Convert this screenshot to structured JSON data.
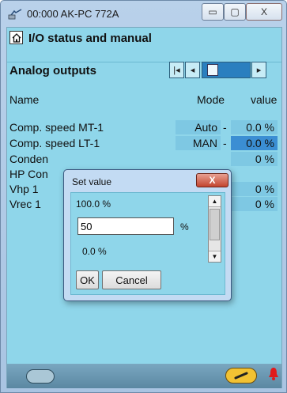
{
  "window": {
    "title": "00:000 AK-PC 772A",
    "min_glyph": "▭",
    "max_glyph": "▢",
    "close_glyph": "X"
  },
  "header": {
    "page_title": "I/O status and manual",
    "section_title": "Analog outputs",
    "nav": {
      "first": "|◂",
      "prev": "◂",
      "next": "▸"
    }
  },
  "table": {
    "headers": {
      "name": "Name",
      "mode": "Mode",
      "value": "value"
    },
    "rows": [
      {
        "name": "Comp. speed MT-1",
        "mode": "Auto",
        "dash": "-",
        "value": "0.0 %"
      },
      {
        "name": "Comp. speed LT-1",
        "mode": "MAN",
        "dash": "-",
        "value": "0.0 %"
      },
      {
        "name": "Conden",
        "mode": "",
        "dash": "",
        "value": "0 %"
      },
      {
        "name": "HP Con",
        "mode": "",
        "dash": "",
        "value": ""
      },
      {
        "name": "Vhp 1",
        "mode": "",
        "dash": "",
        "value": "0 %"
      },
      {
        "name": "Vrec 1",
        "mode": "",
        "dash": "",
        "value": "0 %"
      }
    ]
  },
  "dialog": {
    "title": "Set value",
    "close_glyph": "X",
    "max_label": "100.0 %",
    "input_value": "50",
    "unit": "%",
    "min_label": "0.0 %",
    "ok_label": "OK",
    "cancel_label": "Cancel"
  },
  "colors": {
    "panel": "#8fd6ea",
    "cell": "#7ec8e3",
    "selected_cell": "#3b8ed3",
    "close_red": "#c3452f"
  }
}
